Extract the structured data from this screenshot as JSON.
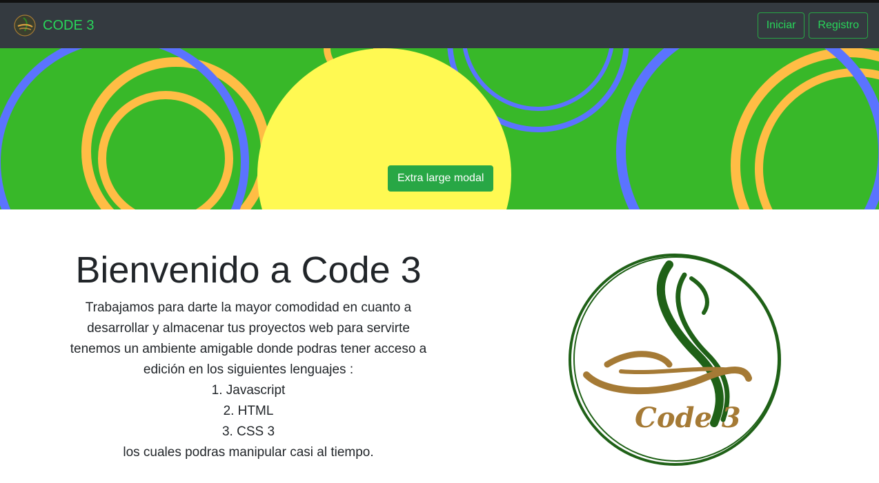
{
  "navbar": {
    "brand": "CODE 3",
    "login_label": "Iniciar",
    "register_label": "Registro"
  },
  "hero": {
    "button_label": "Extra large modal"
  },
  "main": {
    "title": "Bienvenido a Code 3",
    "intro": "Trabajamos para darte la mayor comodidad en cuanto a desarrollar y almacenar tus proyectos web para servirte tenemos un ambiente amigable donde podras tener acceso a edición en los siguientes lenguajes :",
    "languages": [
      "1. Javascript",
      "2. HTML",
      "3. CSS 3"
    ],
    "outro": "los cuales podras manipular casi al tiempo.",
    "logo_text": "Code 3"
  },
  "colors": {
    "navbar_bg": "#343a40",
    "brand_green": "#28d65a",
    "hero_green": "#38b829",
    "hero_yellow": "#fff952",
    "ring_orange": "#ffbd45",
    "ring_blue": "#5b73ff",
    "logo_green": "#1f6117",
    "logo_gold": "#a57a35"
  }
}
